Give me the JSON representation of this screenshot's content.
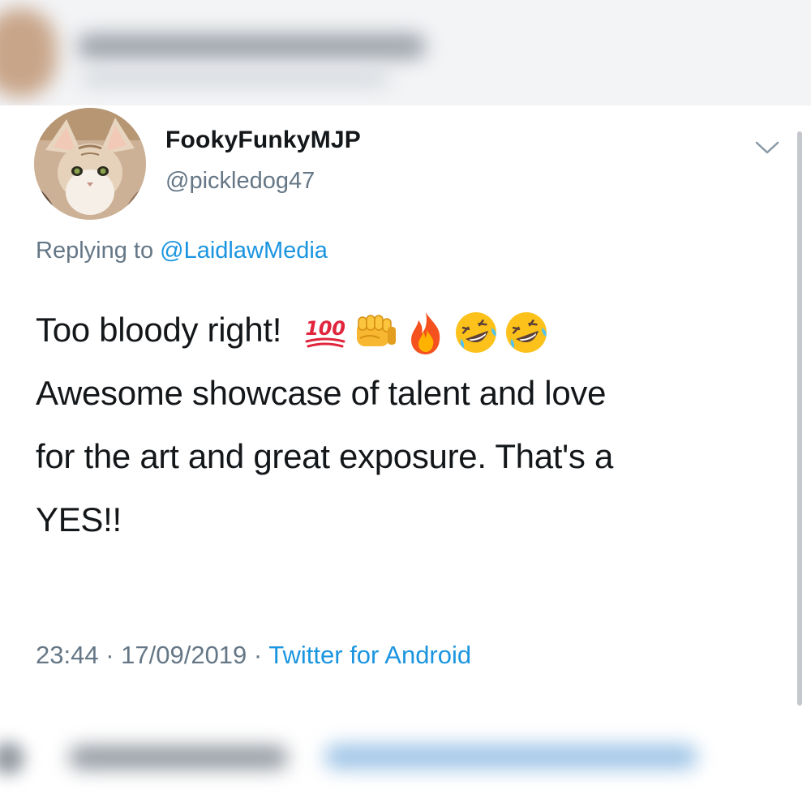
{
  "tweet": {
    "display_name": "FookyFunkyMJP",
    "handle": "@pickledog47",
    "replying_prefix": "Replying to ",
    "replying_to": "@LaidlawMedia",
    "body_line1": "Too bloody right!",
    "body_line2": "Awesome showcase of talent and love",
    "body_line3": "for the art and great exposure. That's a",
    "body_line4": "YES!!",
    "emoji_hundred_text": "100",
    "emojis": [
      "hundred-points-icon",
      "oncoming-fist-icon",
      "fire-icon",
      "rolling-on-floor-laughing-icon",
      "rolling-on-floor-laughing-icon"
    ],
    "time": "23:44",
    "separator": " · ",
    "date": "17/09/2019",
    "source": "Twitter for Android"
  },
  "colors": {
    "primary_text": "#14171a",
    "secondary_text": "#657786",
    "link": "#1b95e0",
    "background": "#ffffff"
  }
}
